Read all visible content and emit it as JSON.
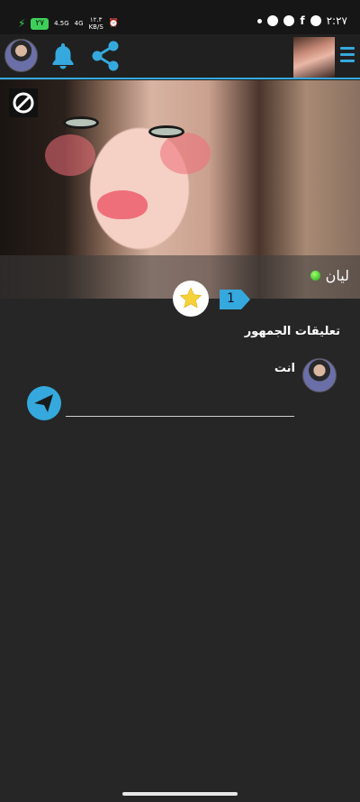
{
  "status_bar": {
    "time": "٢:٢٧",
    "battery": "٢٧",
    "network_1": "4.5G",
    "network_2": "4G",
    "speed": "١٢.٣",
    "speed_unit": "KB/S"
  },
  "profile": {
    "name": "ليان",
    "online": true,
    "star_count": "1"
  },
  "comments": {
    "title": "تعليقات الجمهور",
    "items": [
      {
        "author": "انت"
      }
    ],
    "input_value": ""
  },
  "colors": {
    "accent": "#35a9dd",
    "background": "#262626",
    "online": "#2ecc1f"
  }
}
